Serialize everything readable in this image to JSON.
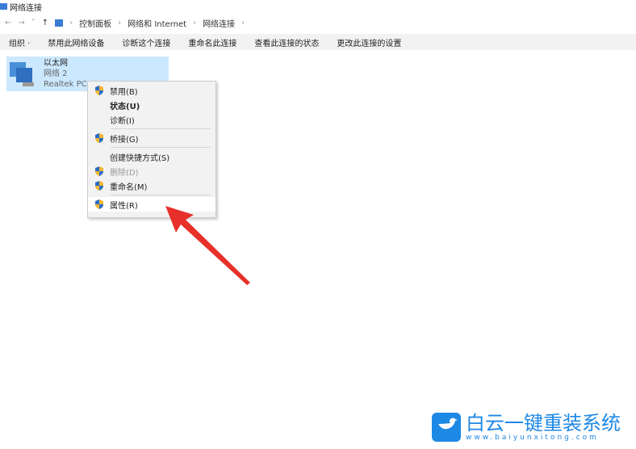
{
  "window": {
    "title": "网络连接"
  },
  "breadcrumb": [
    "控制面板",
    "网络和 Internet",
    "网络连接"
  ],
  "toolbar": {
    "organize": "组织 ·",
    "disable": "禁用此网络设备",
    "diagnose": "诊断这个连接",
    "rename": "重命名此连接",
    "status": "查看此连接的状态",
    "settings": "更改此连接的设置"
  },
  "adapter": {
    "name": "以太网",
    "network": "网络 2",
    "device": "Realtek PCIe"
  },
  "menu": [
    {
      "label": "禁用(B)",
      "shield": true
    },
    {
      "label": "状态(U)",
      "bold": true
    },
    {
      "label": "诊断(I)"
    },
    {
      "label": "桥接(G)",
      "shield": true
    },
    {
      "label": "创建快捷方式(S)"
    },
    {
      "label": "删除(D)",
      "shield": true,
      "disabled": true
    },
    {
      "label": "重命名(M)",
      "shield": true
    },
    {
      "label": "属性(R)",
      "shield": true,
      "highlighted": true
    }
  ],
  "watermark": {
    "brand": "白云一键重装系统",
    "url": "www.baiyunxitong.com"
  },
  "colors": {
    "accent": "#1e88e5",
    "arrow": "#e8302a"
  }
}
